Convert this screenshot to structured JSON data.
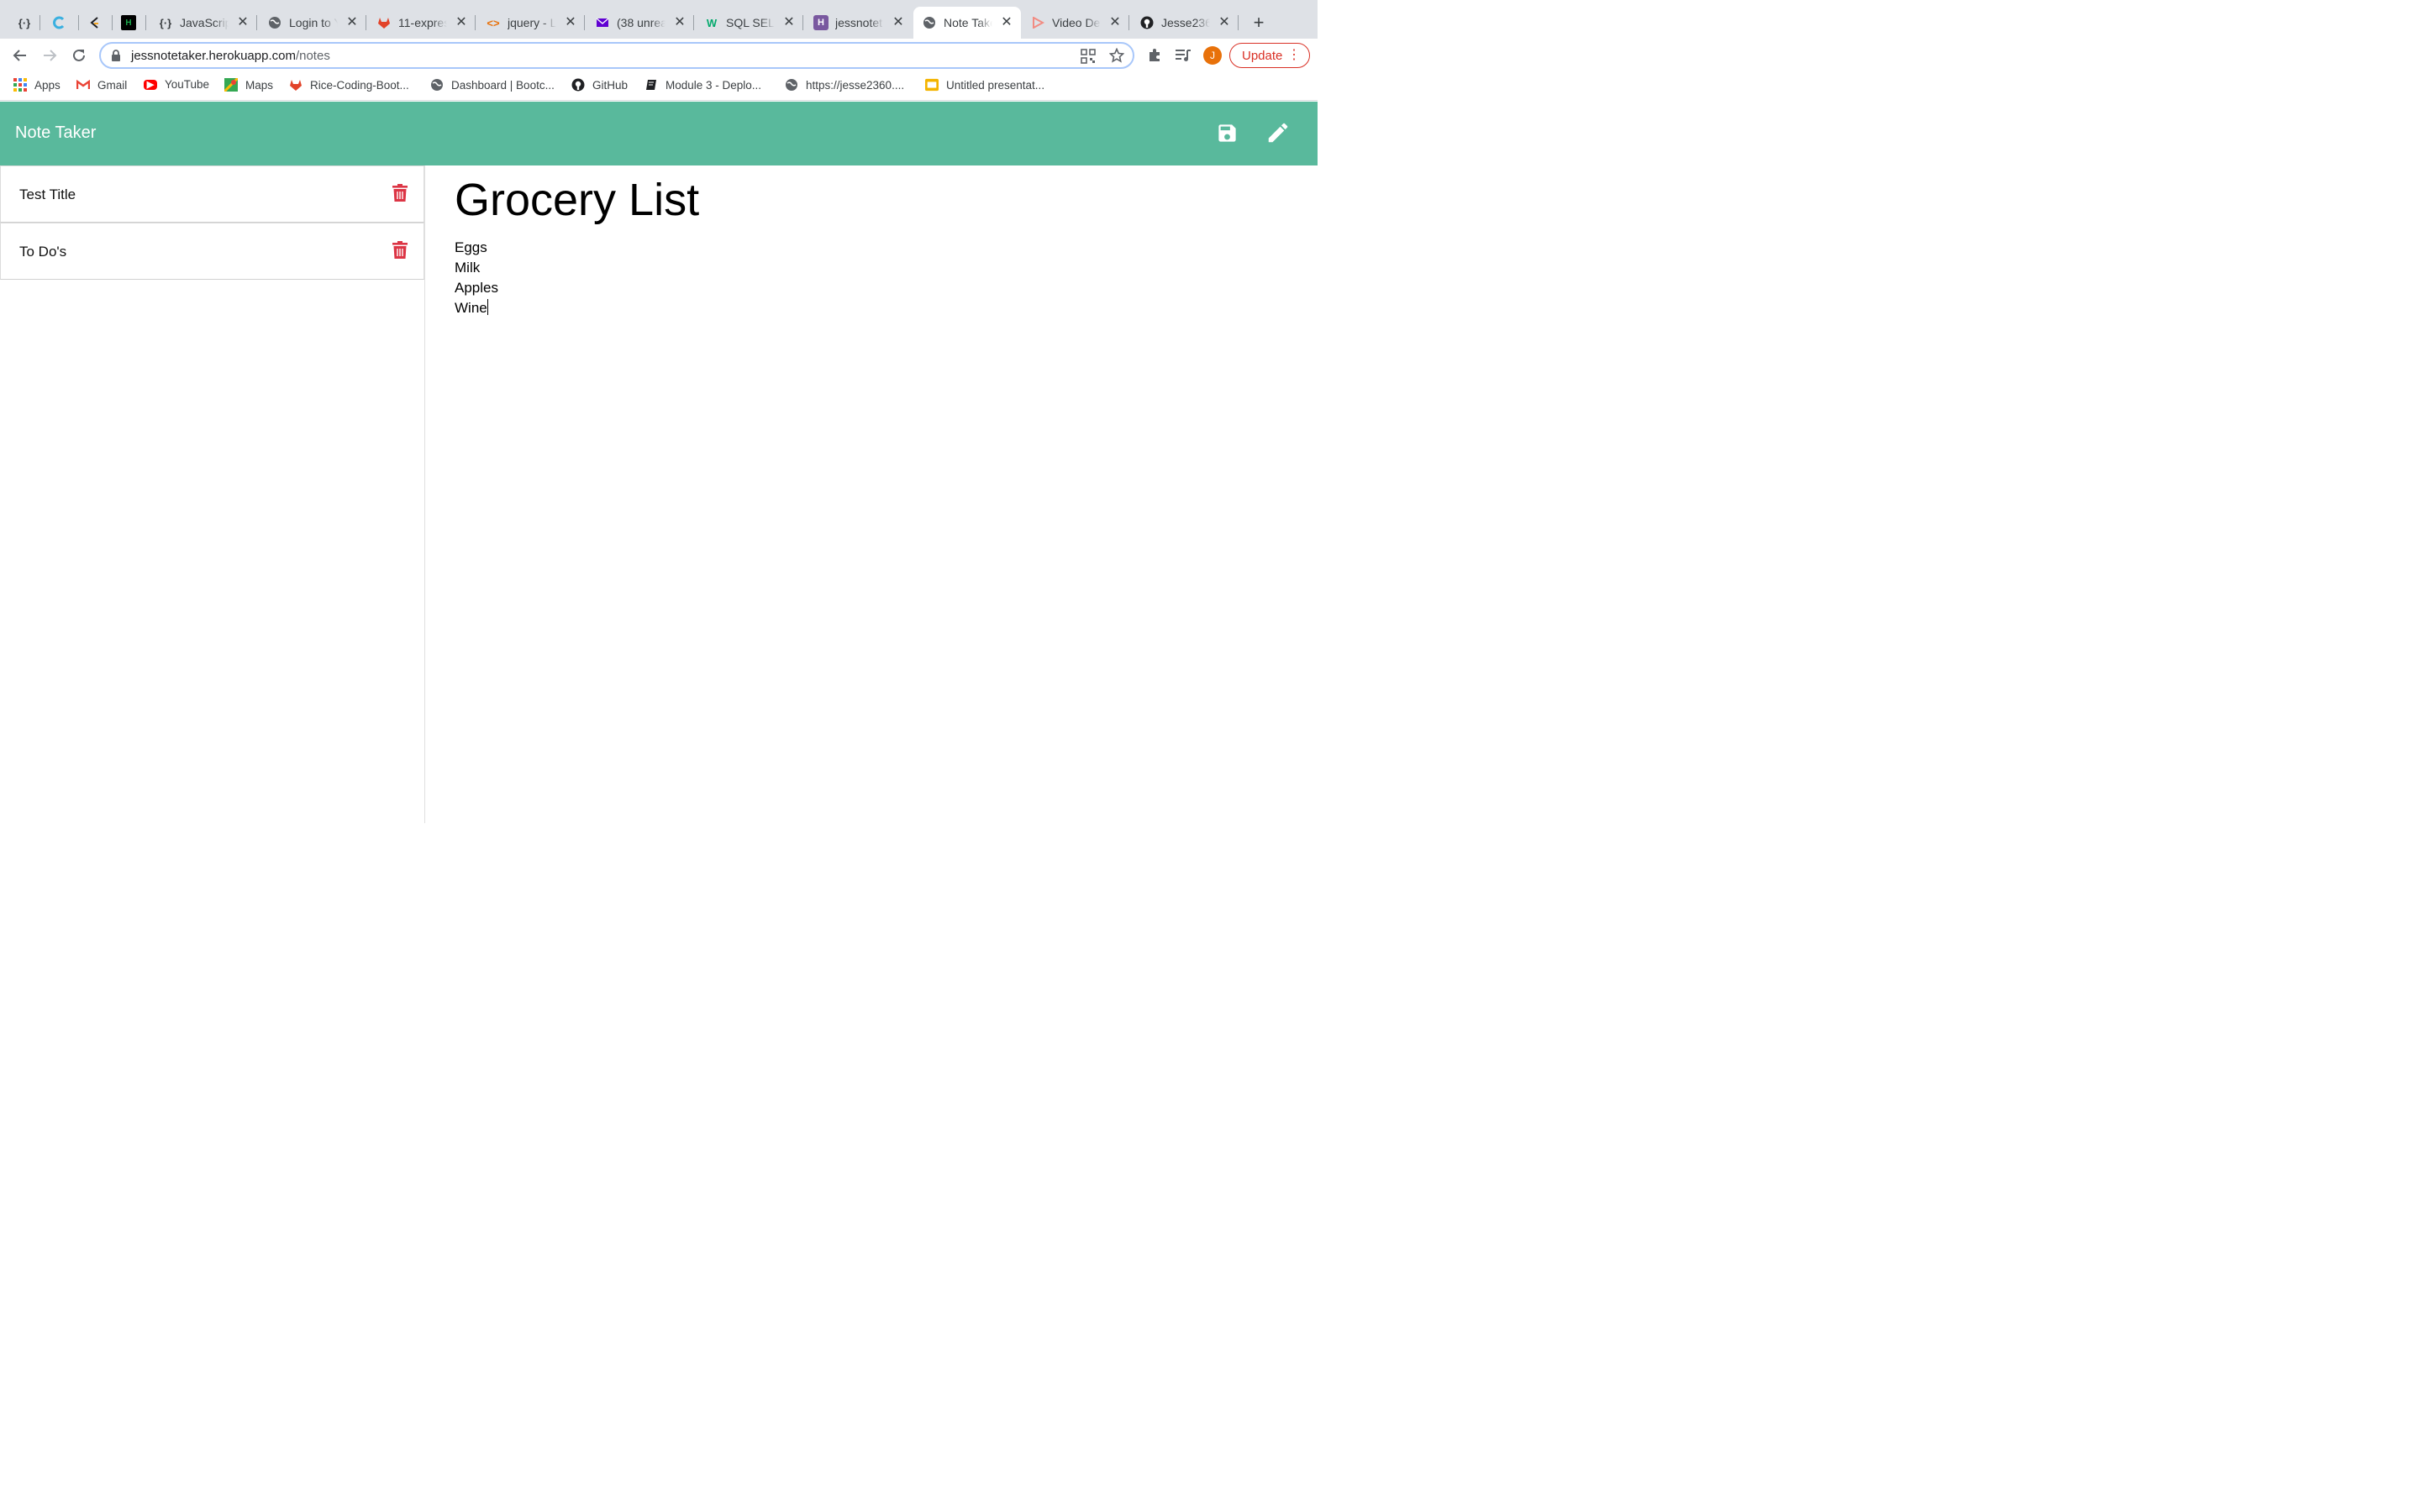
{
  "browser": {
    "tabs": [
      {
        "title": "",
        "icon": "braces-icon"
      },
      {
        "title": "",
        "icon": "c-logo-icon"
      },
      {
        "title": "",
        "icon": "codepen-logo-icon"
      },
      {
        "title": "",
        "icon": "hackerrank-icon"
      },
      {
        "title": "JavaScrip",
        "icon": "braces-icon"
      },
      {
        "title": "Login to Y",
        "icon": "globe-icon"
      },
      {
        "title": "11-expres",
        "icon": "gitlab-icon"
      },
      {
        "title": "jquery - L",
        "icon": "code-brackets-icon"
      },
      {
        "title": "(38 unrea",
        "icon": "mail-icon"
      },
      {
        "title": "SQL SELE",
        "icon": "w3schools-icon"
      },
      {
        "title": "jessnotet",
        "icon": "heroku-icon"
      },
      {
        "title": "Note Take",
        "icon": "globe-icon",
        "active": true
      },
      {
        "title": "Video Det",
        "icon": "video-icon"
      },
      {
        "title": "Jesse236",
        "icon": "github-icon"
      }
    ],
    "url_host": "jessnotetaker.herokuapp.com",
    "url_path": "/notes",
    "profile_initial": "J",
    "update_label": "Update",
    "bookmarks": [
      {
        "label": "Apps",
        "icon": "apps-grid-icon"
      },
      {
        "label": "Gmail",
        "icon": "gmail-icon"
      },
      {
        "label": "YouTube",
        "icon": "youtube-icon"
      },
      {
        "label": "Maps",
        "icon": "maps-icon"
      },
      {
        "label": "Rice-Coding-Boot...",
        "icon": "gitlab-icon"
      },
      {
        "label": "Dashboard | Bootc...",
        "icon": "globe-icon"
      },
      {
        "label": "GitHub",
        "icon": "github-icon"
      },
      {
        "label": "Module 3 - Deplo...",
        "icon": "book-icon"
      },
      {
        "label": "https://jesse2360....",
        "icon": "globe-icon"
      },
      {
        "label": "Untitled presentat...",
        "icon": "slides-icon"
      }
    ]
  },
  "app": {
    "brand": "Note Taker",
    "colors": {
      "header": "#59b99c",
      "delete": "#dc3545"
    },
    "notes": [
      {
        "title": "Test Title"
      },
      {
        "title": "To Do's"
      }
    ],
    "active_note": {
      "title": "Grocery List",
      "body": "Eggs\nMilk\nApples\nWine"
    }
  }
}
